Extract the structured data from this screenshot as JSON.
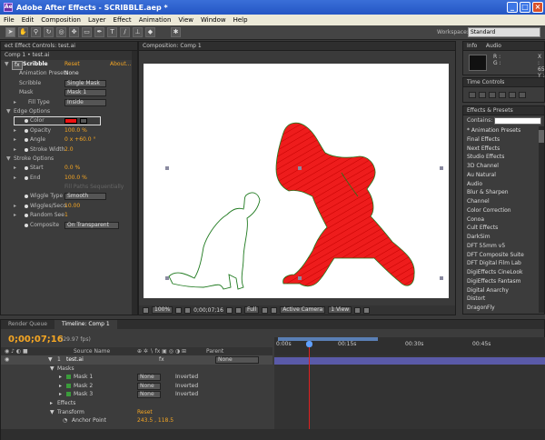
{
  "window": {
    "title": "Adobe After Effects - SCRIBBLE.aep *"
  },
  "menu": [
    "File",
    "Edit",
    "Composition",
    "Layer",
    "Effect",
    "Animation",
    "View",
    "Window",
    "Help"
  ],
  "toolbar": {
    "workspace_label": "Workspace:",
    "workspace_value": "Standard"
  },
  "effect_controls": {
    "tab_title": "ect  Effect Controls: test.ai",
    "comp_line": "Comp 1 • test.ai",
    "effect_name": "Scribble",
    "reset": "Reset",
    "about": "About...",
    "rows": [
      {
        "label": "Animation Presets",
        "value": "None"
      },
      {
        "label": "Scribble",
        "value": "Single Mask"
      },
      {
        "label": "Mask",
        "value": "Mask 1"
      },
      {
        "label": "Fill Type",
        "value": "Inside"
      },
      {
        "label": "Edge Options",
        "value": ""
      },
      {
        "label": "Color",
        "value": ""
      },
      {
        "label": "Opacity",
        "value": "100.0 %"
      },
      {
        "label": "Angle",
        "value": "0 x +60.0 °"
      },
      {
        "label": "Stroke Width",
        "value": "2.0"
      },
      {
        "label": "Stroke Options",
        "value": ""
      },
      {
        "label": "Start",
        "value": "0.0 %"
      },
      {
        "label": "End",
        "value": "100.0 %"
      },
      {
        "label": "",
        "value": "Fill Paths Sequentially"
      },
      {
        "label": "Wiggle Type",
        "value": "Smooth"
      },
      {
        "label": "Wiggles/Seco",
        "value": "10.00"
      },
      {
        "label": "Random See",
        "value": "1"
      },
      {
        "label": "Composite",
        "value": "On Transparent"
      }
    ]
  },
  "composition": {
    "tab_title": "Composition: Comp 1",
    "zoom": "100%",
    "timecode": "0;00;07;16",
    "resolution": "Full",
    "camera": "Active Camera",
    "view": "1 View"
  },
  "info": {
    "tab": "Info",
    "tab2": "Audio",
    "r": "R :",
    "g": "G :",
    "x": "X : 65",
    "y": "Y : 2"
  },
  "time_controls": {
    "tab": "Time Controls"
  },
  "effects_presets": {
    "tab": "Effects & Presets",
    "contains_label": "Contains:",
    "items": [
      "* Animation Presets",
      "Final Effects",
      "Next Effects",
      "Studio Effects",
      "3D Channel",
      "Au Natural",
      "Audio",
      "Blur & Sharpen",
      "Channel",
      "Color Correction",
      "Conoa",
      "Cult Effects",
      "DarkSim",
      "DFT 55mm v5",
      "DFT Composite Suite",
      "DFT Digital Film Lab",
      "DigiEffects CineLook",
      "DigiEffects Fantasm",
      "Digital Anarchy",
      "Distort",
      "DragonFly"
    ]
  },
  "timeline": {
    "tabs": [
      "Render Queue",
      "Timeline: Comp 1"
    ],
    "time": "0;00;07;16",
    "fps": "(29.97 fps)",
    "col_source": "Source Name",
    "col_parent": "Parent",
    "layer_num": "1",
    "layer_name": "test.ai",
    "layer_parent": "None",
    "masks_label": "Masks",
    "masks": [
      {
        "name": "Mask 1",
        "mode": "None",
        "inv": "Inverted"
      },
      {
        "name": "Mask 2",
        "mode": "None",
        "inv": "Inverted"
      },
      {
        "name": "Mask 3",
        "mode": "None",
        "inv": "Inverted"
      }
    ],
    "effects_label": "Effects",
    "transform_label": "Transform",
    "transform_reset": "Reset",
    "anchor_label": "Anchor Point",
    "anchor_value": "243.5 , 118.5",
    "ruler": [
      "0:00s",
      "00:15s",
      "00:30s",
      "00:45s"
    ]
  }
}
